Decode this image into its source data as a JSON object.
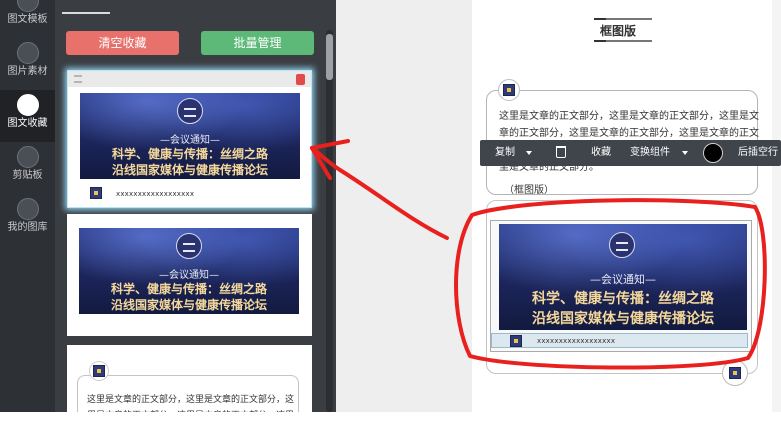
{
  "sidebar": {
    "items": [
      {
        "label": "图文模板",
        "icon": "template-icon"
      },
      {
        "label": "图片素材",
        "icon": "image-icon"
      },
      {
        "label": "图文收藏",
        "icon": "favorite-icon",
        "active": true
      },
      {
        "label": "剪贴板",
        "icon": "clipboard-icon"
      },
      {
        "label": "我的图库",
        "icon": "gallery-icon"
      }
    ]
  },
  "favorites": {
    "clear_button": "清空收藏",
    "batch_button": "批量管理",
    "card1": {
      "notice": "—会议通知—",
      "line1": "科学、健康与传播：丝绸之路",
      "line2": "沿线国家媒体与健康传播论坛",
      "caption": "xxxxxxxxxxxxxxxxxx"
    },
    "card2": {
      "notice": "—会议通知—",
      "line1": "科学、健康与传播：丝绸之路",
      "line2": "沿线国家媒体与健康传播论坛"
    },
    "card3": {
      "text": "这里是文章的正文部分，这里是文章的正文部分，这里是文章的正文部分，这里是文章的正文部分，这里"
    }
  },
  "editor": {
    "section_title": "框图版",
    "article_body": "这里是文章的正文部分，这里是文章的正文部分，这里是文章的正文部分，这里是文章的正文部分，这里是文章的正文部分，这里是文章的正文部分，这里是文章的正文部分，这里是文章的正文部分。",
    "article_tail": "（框图版）",
    "toolbar": {
      "copy": "复制",
      "favorite": "收藏",
      "transform": "变换组件",
      "insert_after": "后插空行"
    },
    "banner": {
      "notice": "—会议通知—",
      "line1": "科学、健康与传播：丝绸之路",
      "line2": "沿线国家媒体与健康传播论坛",
      "caption": "xxxxxxxxxxxxxxxxxx"
    }
  },
  "colors": {
    "clear_button": "#e9716c",
    "batch_button": "#5cb977",
    "annotation": "#e8201e",
    "toolbar": "#40444b"
  }
}
